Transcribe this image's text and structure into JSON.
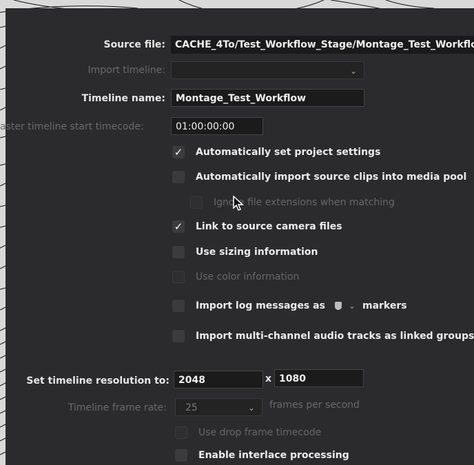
{
  "fields": {
    "source_file": {
      "label": "Source file:",
      "value": "CACHE_4To/Test_Workflow_Stage/Montage_Test_Workflo"
    },
    "import_timeline": {
      "label": "Import timeline:",
      "value": ""
    },
    "timeline_name": {
      "label": "Timeline name:",
      "value": "Montage_Test_Workflow"
    },
    "master_start_tc": {
      "label": "aster timeline start timecode:",
      "value": "01:00:00:00"
    }
  },
  "options": [
    {
      "label": "Automatically set project settings",
      "checked": true,
      "enabled": true
    },
    {
      "label": "Automatically import source clips into media pool",
      "checked": false,
      "enabled": true
    },
    {
      "label": "Ignore file extensions when matching",
      "checked": false,
      "enabled": false
    },
    {
      "label": "Link to source camera files",
      "checked": true,
      "enabled": true
    },
    {
      "label": "Use sizing information",
      "checked": false,
      "enabled": true
    },
    {
      "label": "Use color information",
      "checked": false,
      "enabled": false
    },
    {
      "label": "Import log messages as",
      "checked": false,
      "enabled": true,
      "suffix": "markers",
      "marker_color": "#bdbdbd"
    },
    {
      "label": "Import multi-channel audio tracks as linked groups",
      "checked": false,
      "enabled": true
    }
  ],
  "resolution": {
    "label": "Set timeline resolution to:",
    "width": "2048",
    "separator": "x",
    "height": "1080"
  },
  "frame_rate": {
    "label": "Timeline frame rate:",
    "value": "25",
    "unit": "frames per second"
  },
  "late_options": [
    {
      "label": "Use drop frame timecode",
      "checked": false,
      "enabled": false
    },
    {
      "label": "Enable interlace processing",
      "checked": false,
      "enabled": true
    }
  ],
  "icons": {
    "check": "✓",
    "chevron": "chevron-down-icon",
    "cursor": "mouse-pointer-icon"
  }
}
